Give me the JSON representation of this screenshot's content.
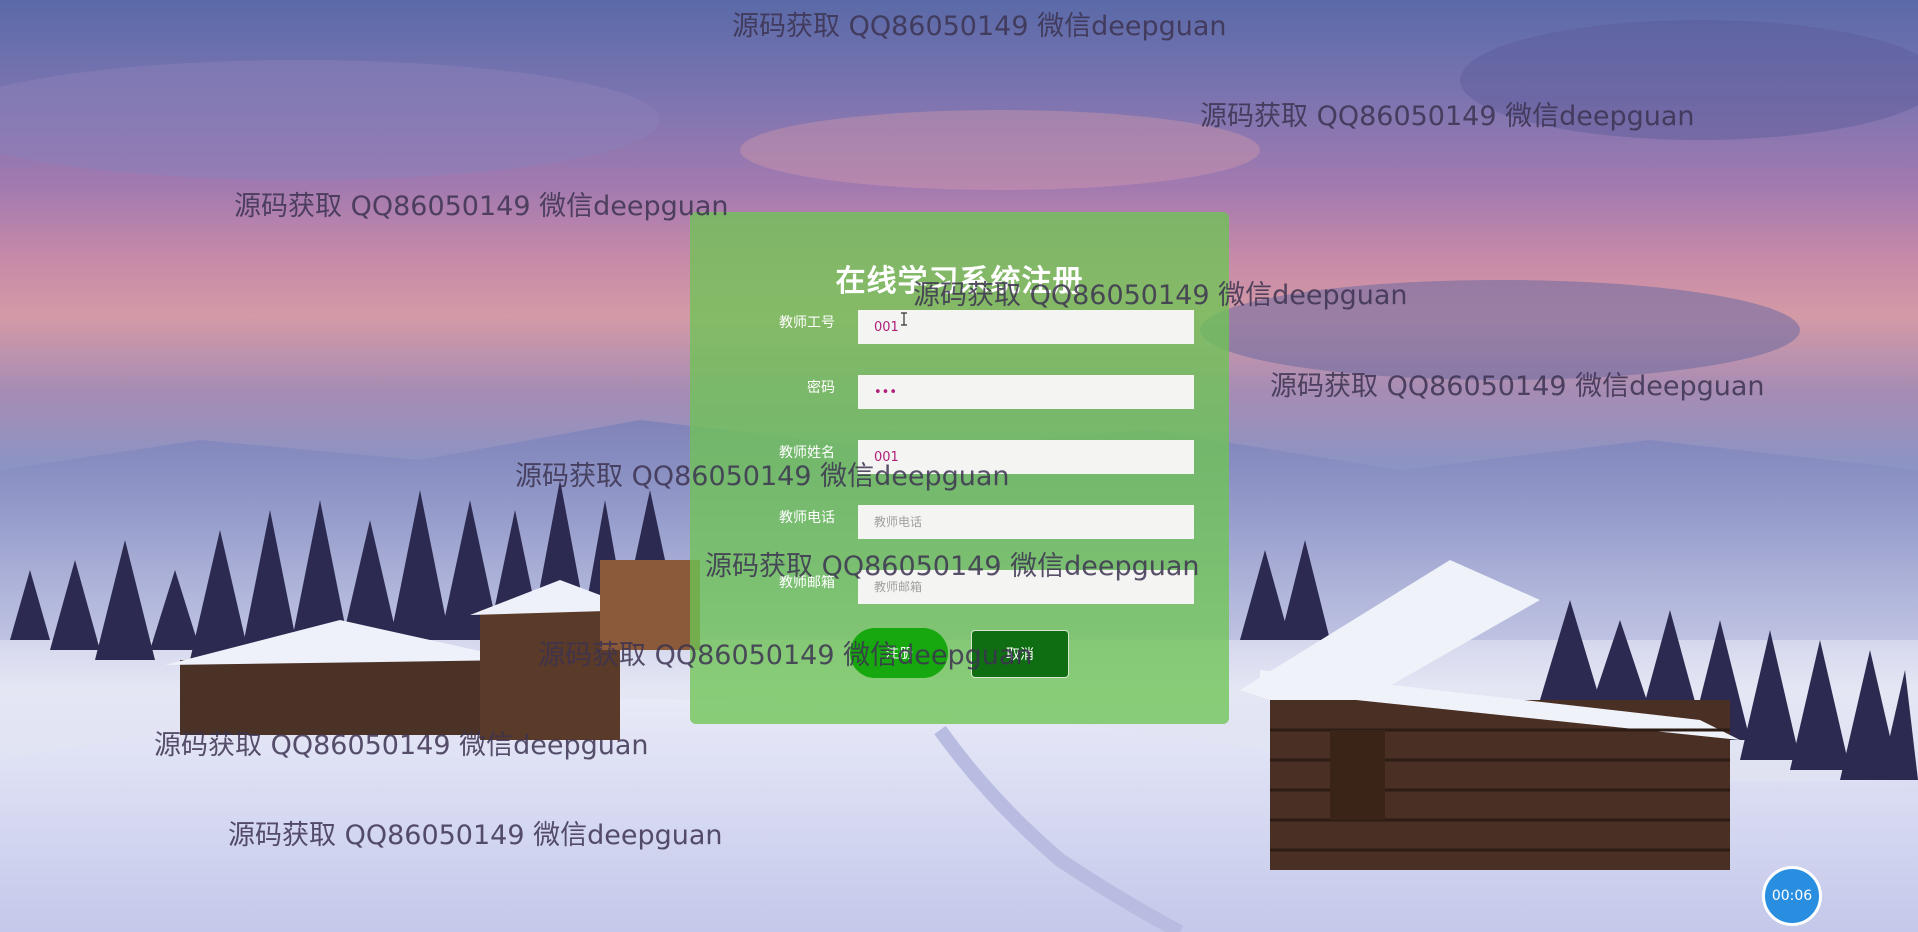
{
  "form": {
    "title": "在线学习系统注册",
    "fields": [
      {
        "label": "教师工号",
        "value": "001",
        "placeholder": "",
        "type": "text"
      },
      {
        "label": "密码",
        "value": "123",
        "placeholder": "",
        "type": "password"
      },
      {
        "label": "教师姓名",
        "value": "001",
        "placeholder": "",
        "type": "text"
      },
      {
        "label": "教师电话",
        "value": "",
        "placeholder": "教师电话",
        "type": "text"
      },
      {
        "label": "教师邮箱",
        "value": "",
        "placeholder": "教师邮箱",
        "type": "text"
      }
    ],
    "register_label": "注册",
    "cancel_label": "取消"
  },
  "watermark_text": "源码获取 QQ86050149 微信deepguan",
  "timer": "00:06",
  "colors": {
    "panel": "#6ec454",
    "register_button": "#16a80e",
    "cancel_button": "#0f6e12",
    "timer_badge": "#2a8ee0"
  }
}
